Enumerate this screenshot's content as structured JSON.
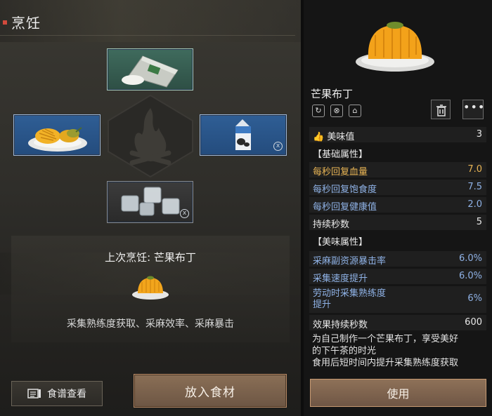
{
  "header": {
    "title": "烹饪"
  },
  "slots": {
    "top": {
      "item": "flour-bag"
    },
    "left": {
      "item": "mango-plate"
    },
    "right": {
      "item": "milk-carton",
      "remove_icon": "x"
    },
    "bottom": {
      "item": "ice-cubes",
      "remove_icon": "x"
    }
  },
  "last_cook": {
    "label": "上次烹饪: 芒果布丁",
    "effects": "采集熟练度获取、采麻效率、采麻暴击"
  },
  "buttons": {
    "recipe": "食谱查看",
    "add_ingredient": "放入食材",
    "use": "使用",
    "more": "•••"
  },
  "item": {
    "name": "芒果布丁",
    "flavor_label": "美味值",
    "flavor_value": "3",
    "basic_section": "【基础属性】",
    "basic": [
      {
        "label": "每秒回复血量",
        "value": "7.0",
        "color": "gold"
      },
      {
        "label": "每秒回复饱食度",
        "value": "7.5",
        "color": "blue"
      },
      {
        "label": "每秒回复健康值",
        "value": "2.0",
        "color": "blue"
      },
      {
        "label": "持续秒数",
        "value": "5",
        "color": "white"
      }
    ],
    "flavor_section": "【美味属性】",
    "flavor": [
      {
        "label": "采麻副资源暴击率",
        "value": "6.0%"
      },
      {
        "label": "采集速度提升",
        "value": "6.0%"
      },
      {
        "label": "劳动时采集熟练度提升",
        "label_line1": "劳动时采集熟练度",
        "label_line2": "提升",
        "value": "6%"
      }
    ],
    "duration_label": "效果持续秒数",
    "duration_value": "600",
    "description_line1": "为自己制作一个芒果布丁，享受美好",
    "description_line2": "的下午茶的时光",
    "description_line3": "食用后短时间内提升采集熟练度获取"
  },
  "colors": {
    "accent": "#d24a3c",
    "gold": "#e8b454",
    "blue": "#8fb2e6",
    "button": "#7c6350"
  }
}
